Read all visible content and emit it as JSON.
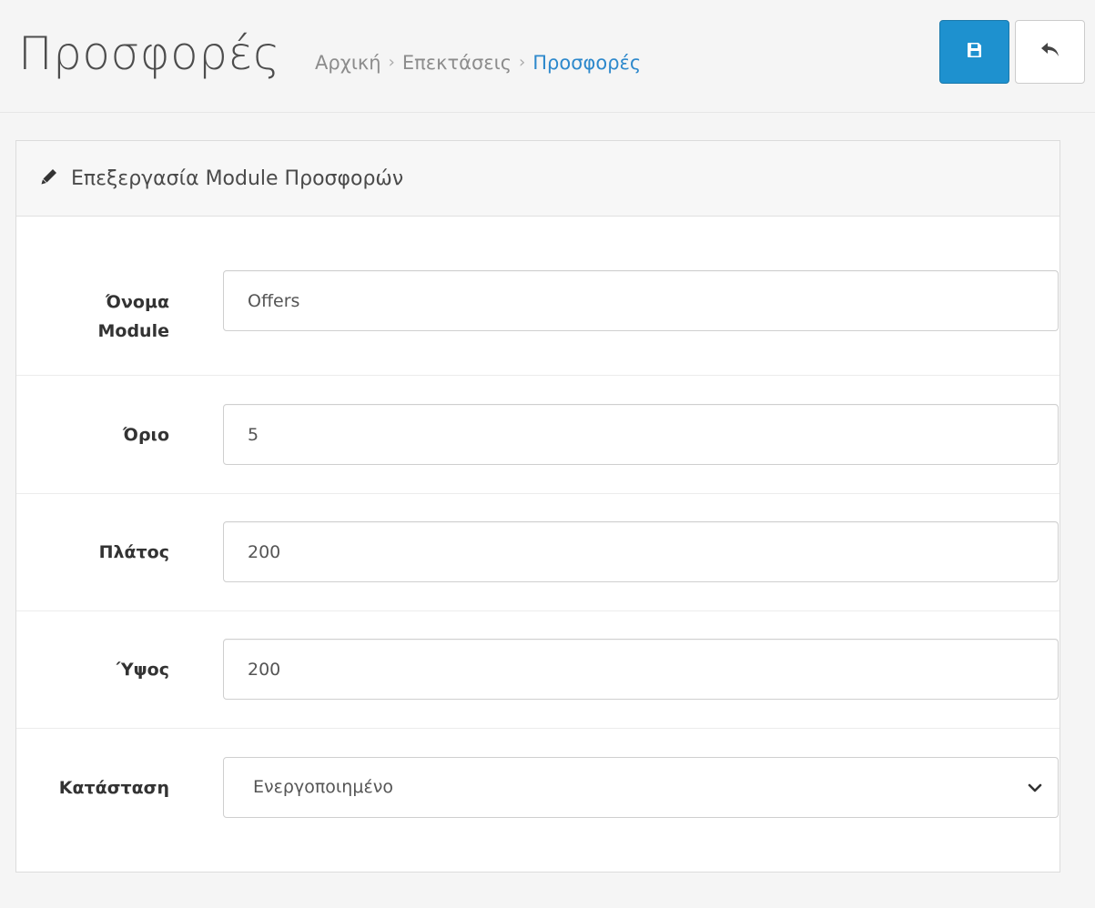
{
  "header": {
    "title": "Προσφορές",
    "breadcrumbs": [
      {
        "label": "Αρχική",
        "active": false
      },
      {
        "label": "Επεκτάσεις",
        "active": false
      },
      {
        "label": "Προσφορές",
        "active": true
      }
    ],
    "separator": "›",
    "save_icon": "floppy-disk-icon",
    "back_icon": "reply-icon"
  },
  "panel": {
    "icon": "pencil-icon",
    "title": "Επεξεργασία Module Προσφορών"
  },
  "form": {
    "name": {
      "label_line1": "Όνομα",
      "label_line2": "Module",
      "value": "Offers"
    },
    "limit": {
      "label": "Όριο",
      "value": "5"
    },
    "width": {
      "label": "Πλάτος",
      "value": "200"
    },
    "height": {
      "label": "Ύψος",
      "value": "200"
    },
    "status": {
      "label": "Κατάσταση",
      "selected": "Ενεργοποιημένο"
    }
  },
  "colors": {
    "primary": "#1e91cf",
    "active_breadcrumb": "#2e89cc"
  }
}
